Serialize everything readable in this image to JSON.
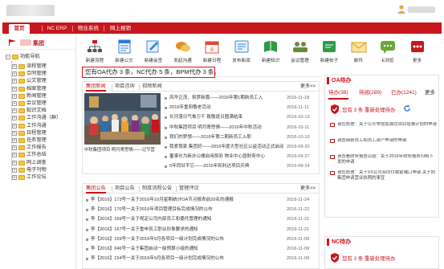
{
  "header": {
    "colors": {
      "brand": "#c8161d",
      "folder": "#f4c542"
    }
  },
  "nav": {
    "tabs": [
      {
        "label": "首页",
        "active": true
      },
      {
        "label": "NC ERP",
        "active": false
      },
      {
        "label": "物业系统",
        "active": false
      },
      {
        "label": "网上报销",
        "active": false
      }
    ]
  },
  "sidebar": {
    "group_label": "集团",
    "root_label": "功能导航",
    "items": [
      {
        "label": "流程管理",
        "expanded": false
      },
      {
        "label": "合同管理",
        "expanded": false
      },
      {
        "label": "公文管理",
        "expanded": false
      },
      {
        "label": "档案管理",
        "expanded": false
      },
      {
        "label": "新闻管理",
        "expanded": false
      },
      {
        "label": "会议管理",
        "expanded": false
      },
      {
        "label": "知识文档",
        "expanded": false
      },
      {
        "label": "工作沟通（群）",
        "expanded": false
      },
      {
        "label": "工作沟通",
        "expanded": false
      },
      {
        "label": "日程管理",
        "expanded": false
      },
      {
        "label": "任务管理",
        "expanded": false
      },
      {
        "label": "工作报告",
        "expanded": false
      },
      {
        "label": "工作总结",
        "expanded": false
      },
      {
        "label": "网上调查",
        "expanded": false
      },
      {
        "label": "电子刊物",
        "expanded": false
      },
      {
        "label": "工作论坛",
        "expanded": false
      }
    ]
  },
  "shortcuts": [
    {
      "label": "新建流程",
      "icon": "org-chart-icon"
    },
    {
      "label": "新建公文",
      "icon": "document-icon"
    },
    {
      "label": "新建会签",
      "icon": "sign-icon"
    },
    {
      "label": "发起沟通",
      "icon": "chat-icon"
    },
    {
      "label": "新建日程",
      "icon": "calendar-icon"
    },
    {
      "label": "发布新闻",
      "icon": "news-icon"
    },
    {
      "label": "新建知识",
      "icon": "knowledge-icon"
    },
    {
      "label": "会议管理",
      "icon": "meeting-icon"
    },
    {
      "label": "新建帖子",
      "icon": "post-icon"
    },
    {
      "label": "邮件",
      "icon": "mail-icon"
    },
    {
      "label": "E浏览",
      "icon": "chat-bubble-icon"
    },
    {
      "label": "更多",
      "icon": "more-icon"
    }
  ],
  "notice": "您有OA代办 3 条，NC代办 5 条，BPM代办 3 条。",
  "news": {
    "tabs": [
      "集团新闻",
      "项目咨询",
      "视频新闻"
    ],
    "more": "更多>>",
    "caption": "中秋集团项目 明月寄思情——记节营",
    "items": [
      {
        "title": "风华正茂，筑梦新篇——2016年第1期新员工入",
        "date": "2016-11-18"
      },
      {
        "title": "2016年重阳敬老活动",
        "date": "2016-11-11"
      },
      {
        "title": "长河落日气象万千 致敬逐日圆满结束",
        "date": "2016-10-13"
      },
      {
        "title": "中秋集团项目 明月寄思情——2016年中秋活动",
        "date": "2016-10-11"
      },
      {
        "title": "我们的梦想——2016年第二期新员工入职",
        "date": "2016-10-10"
      },
      {
        "title": "我爱我家 集团好——2016年度大型社区公益活动正式启动",
        "date": "2016-09-20"
      },
      {
        "title": "董事长为新办公楼启用剪彩 物业中心暨财务中心",
        "date": "2016-09-27"
      },
      {
        "title": "5年同甘不忘——2016年和利达项目庆典",
        "date": "2016-09-14"
      }
    ]
  },
  "notices": {
    "tabs": [
      "集团公告",
      "项目公告",
      "制度流程公告",
      "管理评议"
    ],
    "more": "更多>>",
    "items": [
      {
        "title": "李【2016】173号一关于2016年10月星期统计OA节点报表前20名的通报",
        "date": "2016-11-24"
      },
      {
        "title": "李【2016】170号一关于2016年项目管理目标完成情况的公布",
        "date": "2016-11-22"
      },
      {
        "title": "李【2016】169号一关于规定公司内部员工和委托管理的通知",
        "date": "2016-11-21"
      },
      {
        "title": "李【2016】167号一关于重申员工职业形象要求的通知",
        "date": "2016-11-21"
      },
      {
        "title": "李【2016】159号一关于2016年9月各项目一级计划完成情况的公布",
        "date": "2016-11-09"
      },
      {
        "title": "李【2016】046号一关于集团启动一级预算小组的通知",
        "date": "2016-11-09"
      },
      {
        "title": "李【2016】154号一关于2016年9月各项目一级计划完成情况的公布",
        "date": "2016-11-09"
      }
    ]
  },
  "oa": {
    "title": "OA待办",
    "tabs": [
      {
        "label": "待办(38)"
      },
      {
        "label": "待阅(289)"
      },
      {
        "label": "已办(1241)"
      },
      {
        "label": "更多"
      }
    ],
    "alert": "您有 3 条 重新处理待办",
    "items": [
      "请您处理：关于以头等增加湖北项目增减计划的申请",
      "请查阅新员工和员工资产申请的申请",
      "请查看财务报告公函：关于2016年财务报表归档下发的申请",
      "请您处理：关于XX公司合同付款前端口申请 关于向集团申请营业执照的事宜"
    ]
  },
  "nc": {
    "title": "NC待办",
    "alert": "您有 3 条 重新处理待办"
  }
}
